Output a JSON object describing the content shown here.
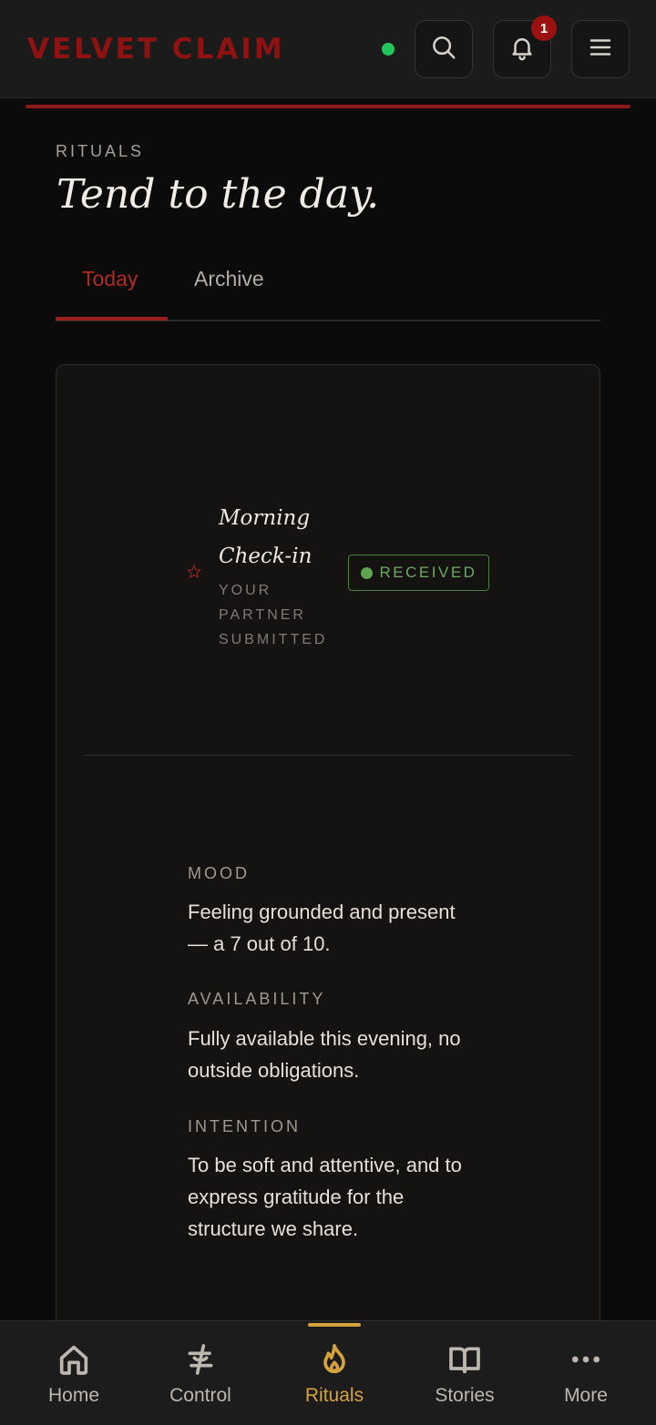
{
  "header": {
    "brand": "VELVET CLAIM",
    "status_color": "#22c55e",
    "notification_count": "1",
    "icons": [
      "search-icon",
      "bell-icon",
      "menu-icon"
    ]
  },
  "page": {
    "eyebrow": "RITUALS",
    "title": "Tend to the day."
  },
  "tabs": [
    {
      "label": "Today",
      "active": true
    },
    {
      "label": "Archive",
      "active": false
    }
  ],
  "ritual": {
    "name": "Morning Check-in",
    "subtitle": "YOUR PARTNER SUBMITTED",
    "status": "RECEIVED",
    "status_color": "#5fa352",
    "fields": [
      {
        "label": "MOOD",
        "value": "Feeling grounded and present — a 7 out of 10."
      },
      {
        "label": "AVAILABILITY",
        "value": "Fully available this evening, no outside obligations."
      },
      {
        "label": "INTENTION",
        "value": "To be soft and attentive, and to express gratitude for the structure we share."
      }
    ]
  },
  "nav": {
    "items": [
      {
        "label": "Home",
        "icon": "home-icon",
        "active": false
      },
      {
        "label": "Control",
        "icon": "control-icon",
        "active": false
      },
      {
        "label": "Rituals",
        "icon": "flame-icon",
        "active": true
      },
      {
        "label": "Stories",
        "icon": "book-icon",
        "active": false
      },
      {
        "label": "More",
        "icon": "more-icon",
        "active": false
      }
    ]
  },
  "colors": {
    "accent_red": "#9b1c1c",
    "accent_gold": "#d4a33b",
    "background": "#0b0b0b"
  }
}
